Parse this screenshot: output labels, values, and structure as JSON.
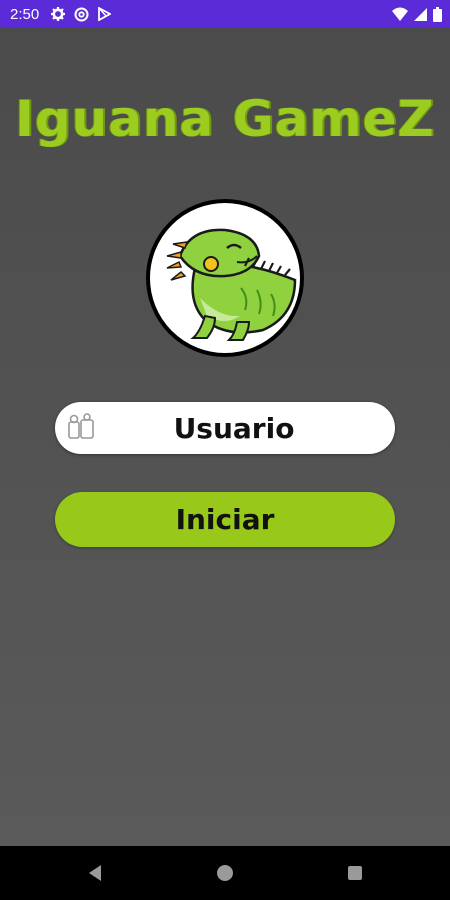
{
  "status_bar": {
    "time": "2:50",
    "left_icons": [
      "gear-icon",
      "at-sign-icon",
      "play-store-icon"
    ],
    "right_icons": [
      "wifi-icon",
      "signal-icon",
      "battery-icon"
    ],
    "background": "#5b2bd8"
  },
  "app": {
    "title": "Iguana GameZ",
    "title_color": "#9bcc1f",
    "logo": "iguana-logo"
  },
  "form": {
    "username_placeholder": "Usuario",
    "username_value": "",
    "start_label": "Iniciar",
    "accent_color": "#98c81a"
  },
  "nav_bar": {
    "buttons": [
      "back-icon",
      "home-icon",
      "recents-icon"
    ]
  }
}
